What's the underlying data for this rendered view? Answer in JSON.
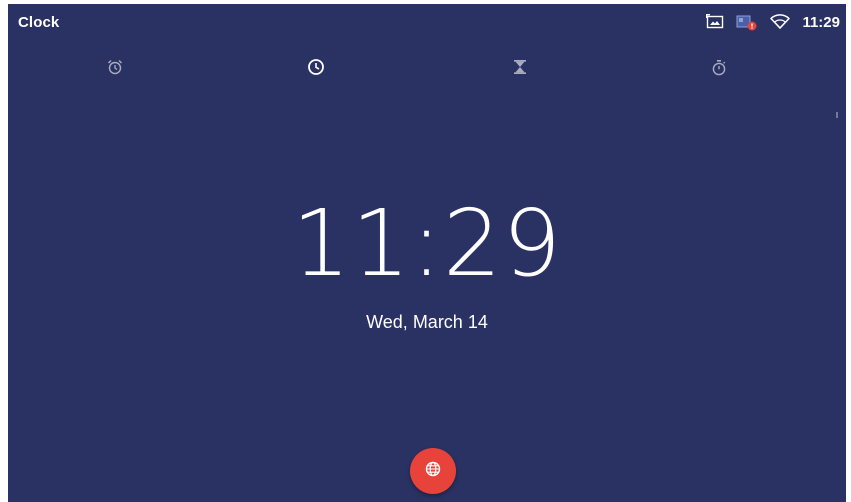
{
  "app": {
    "title": "Clock"
  },
  "status_bar": {
    "time": "11:29",
    "icons": [
      "screenshot-icon",
      "network-alert-icon",
      "wifi-icon"
    ],
    "alert_color": "#e8433a"
  },
  "tabs": [
    {
      "name": "alarm",
      "icon": "alarm-icon",
      "selected": false
    },
    {
      "name": "clock",
      "icon": "clock-icon",
      "selected": true
    },
    {
      "name": "timer",
      "icon": "hourglass-icon",
      "selected": false
    },
    {
      "name": "stopwatch",
      "icon": "stopwatch-icon",
      "selected": false
    }
  ],
  "clock": {
    "time": "11:29",
    "date": "Wed, March 14"
  },
  "fab": {
    "icon": "globe-icon",
    "color": "#e8433a"
  },
  "colors": {
    "background": "#2a3263",
    "accent": "#e8433a"
  }
}
